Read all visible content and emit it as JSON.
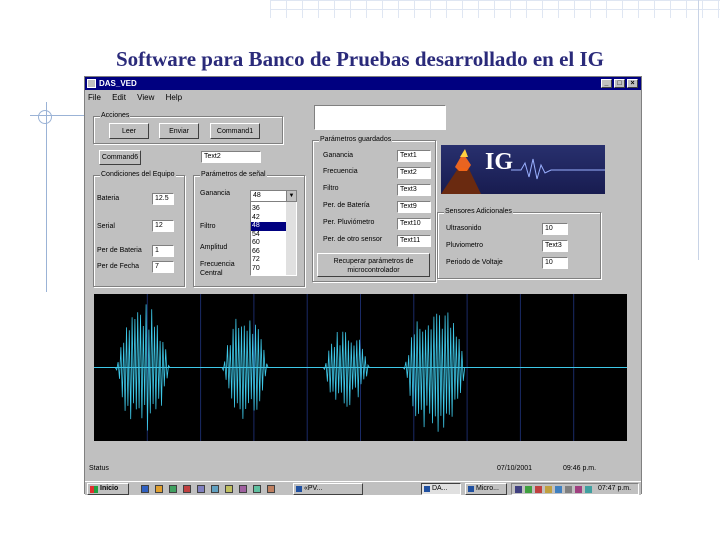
{
  "slide": {
    "title": "Software para Banco de Pruebas desarrollado en el IG"
  },
  "window": {
    "title": "DAS_VED",
    "controls": [
      "_",
      "□",
      "×"
    ]
  },
  "menu": [
    "File",
    "Edit",
    "View",
    "Help"
  ],
  "acciones": {
    "label": "Acciones",
    "buttons": [
      "Leer",
      "Enviar",
      "Command1"
    ]
  },
  "command6_label": "Command6",
  "text2_value": "Text2",
  "condiciones": {
    "label": "Condiciones del Equipo",
    "rows": [
      {
        "label": "Bateria",
        "value": "12.5"
      },
      {
        "label": "Serial",
        "value": "12"
      },
      {
        "label": "Per de Bateria",
        "value": "1"
      },
      {
        "label": "Per de Fecha",
        "value": "7"
      }
    ]
  },
  "param_senal": {
    "label": "Parámetros de señal",
    "rows": [
      {
        "label": "Ganancia"
      },
      {
        "label": "Filtro"
      },
      {
        "label": "Amplitud"
      },
      {
        "label": "Frecuencia Central"
      }
    ],
    "combo_value": "48",
    "list_items": [
      "36",
      "42",
      "48",
      "54",
      "60",
      "66",
      "72",
      "70"
    ],
    "selected_index": 2
  },
  "param_guardados": {
    "label": "Parámetros guardados",
    "rows": [
      {
        "label": "Ganancia",
        "value": "Text1"
      },
      {
        "label": "Frecuencia",
        "value": "Text2"
      },
      {
        "label": "Filtro",
        "value": "Text3"
      },
      {
        "label": "Per. de Batería",
        "value": "Text9"
      },
      {
        "label": "Per. Pluviómetro",
        "value": "Text10"
      },
      {
        "label": "Per. de otro sensor",
        "value": "Text11"
      }
    ],
    "recover_button": "Recuperar parámetros de microcontrolador"
  },
  "logo": {
    "text": "IG"
  },
  "sensores": {
    "label": "Sensores Adicionales",
    "rows": [
      {
        "label": "Ultrasonido",
        "value": "10"
      },
      {
        "label": "Pluviometro",
        "value": "Text3"
      },
      {
        "label": "Periodo de Voltaje",
        "value": "10"
      }
    ]
  },
  "colors": {
    "window_bg": "#c0c0c0",
    "titlebar": "#000080",
    "scope_bg": "#000000",
    "trace": "#3ec8e8",
    "slide_title": "#2a2a7a"
  },
  "scope": {
    "bursts": [
      {
        "start": 0.04,
        "end": 0.17,
        "amplitude": 0.95
      },
      {
        "start": 0.24,
        "end": 0.35,
        "amplitude": 0.8
      },
      {
        "start": 0.43,
        "end": 0.54,
        "amplitude": 0.6
      },
      {
        "start": 0.58,
        "end": 0.73,
        "amplitude": 0.98
      }
    ]
  },
  "status": {
    "label": "Status",
    "date": "07/10/2001",
    "time": "09:46 p.m."
  },
  "taskbar": {
    "start": "Inicio",
    "tasks": [
      "«PV...",
      "DA...",
      "Micro..."
    ],
    "tray_time": "07:47 p.m."
  }
}
